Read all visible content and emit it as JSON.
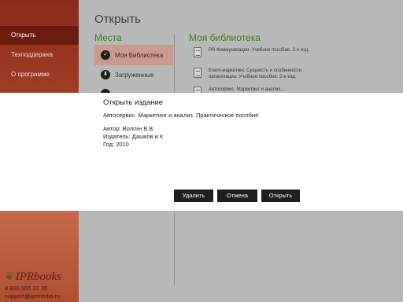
{
  "sidebar": {
    "items": [
      {
        "label": "Открыть"
      },
      {
        "label": "Техподдержка"
      },
      {
        "label": "О программе"
      }
    ],
    "logo": "IPRbooks",
    "phone": "8 800 555 22 35",
    "email": "support@iprmedia.ru"
  },
  "header": {
    "title": "Открыть"
  },
  "places": {
    "heading": "Места",
    "items": [
      {
        "label": "Моя Библиотека",
        "icon": "check-icon"
      },
      {
        "label": "Загруженные",
        "icon": "download-icon"
      },
      {
        "label": "",
        "icon": "circle-icon"
      }
    ]
  },
  "library": {
    "heading": "Моя библиотека",
    "books": [
      {
        "title": "PR-Коммуникации. Учебное пособие. 2-е изд."
      },
      {
        "title": "Event-маркетинг. Сущность и особенности организации. Учебное пособие. 2-е изд."
      },
      {
        "title": "Автосервис. Маркетинг и анализ..."
      }
    ]
  },
  "dialog": {
    "title": "Открыть издание",
    "book_title": "Автосервис. Маркетинг и анализ. Практическое пособие",
    "author": "Автор: Волгин В.В.",
    "publisher": "Издатель: Дашков и К",
    "year": "Год: 2010",
    "buttons": {
      "delete": "Удалить",
      "cancel": "Отмена",
      "open": "Открыть"
    }
  },
  "colors": {
    "sidebar": "#a8432b",
    "sidebar_active": "#6a1b0e",
    "section_heading": "#3f7a1e",
    "button": "#1f1f1f"
  }
}
